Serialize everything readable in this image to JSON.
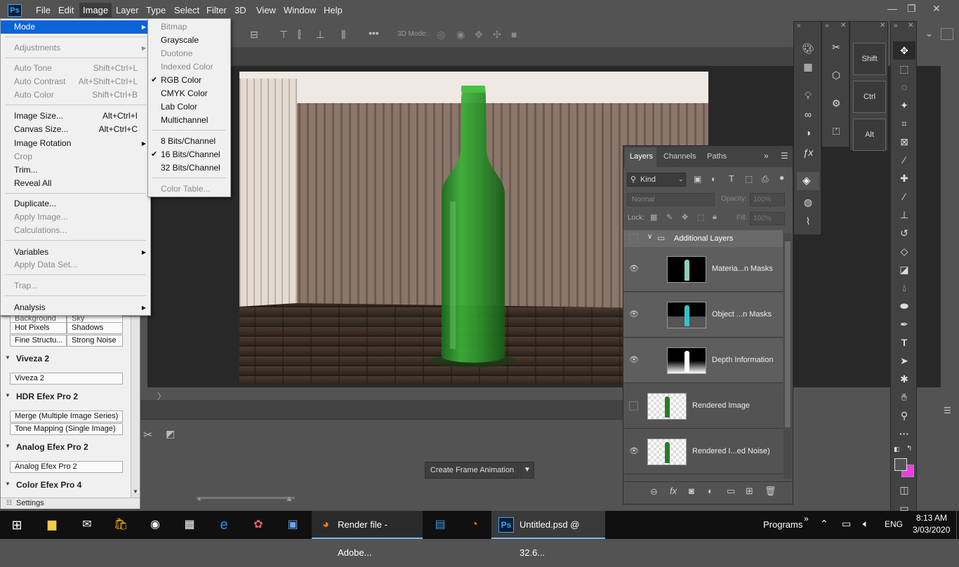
{
  "app": {
    "logo": "Ps"
  },
  "menubar": {
    "items": [
      "File",
      "Edit",
      "Image",
      "Layer",
      "Type",
      "Select",
      "Filter",
      "3D",
      "View",
      "Window",
      "Help"
    ],
    "active": "Image"
  },
  "window_controls": {
    "minimize": "—",
    "restore": "❐",
    "close": "✕"
  },
  "options_bar": {
    "mode_label": "3D Mode:",
    "more": "•••"
  },
  "image_menu": {
    "mode": "Mode",
    "adjustments": "Adjustments",
    "auto_tone": "Auto Tone",
    "auto_tone_sc": "Shift+Ctrl+L",
    "auto_contrast": "Auto Contrast",
    "auto_contrast_sc": "Alt+Shift+Ctrl+L",
    "auto_color": "Auto Color",
    "auto_color_sc": "Shift+Ctrl+B",
    "image_size": "Image Size...",
    "image_size_sc": "Alt+Ctrl+I",
    "canvas_size": "Canvas Size...",
    "canvas_size_sc": "Alt+Ctrl+C",
    "image_rotation": "Image Rotation",
    "crop": "Crop",
    "trim": "Trim...",
    "reveal_all": "Reveal All",
    "duplicate": "Duplicate...",
    "apply_image": "Apply Image...",
    "calculations": "Calculations...",
    "variables": "Variables",
    "apply_data_set": "Apply Data Set...",
    "trap": "Trap...",
    "analysis": "Analysis"
  },
  "mode_submenu": {
    "bitmap": "Bitmap",
    "grayscale": "Grayscale",
    "duotone": "Duotone",
    "indexed_color": "Indexed Color",
    "rgb_color": "RGB Color",
    "cmyk_color": "CMYK Color",
    "lab_color": "Lab Color",
    "multichannel": "Multichannel",
    "bits8": "8 Bits/Channel",
    "bits16": "16 Bits/Channel",
    "bits32": "32 Bits/Channel",
    "color_table": "Color Table...",
    "check": "✔"
  },
  "nik_panel": {
    "row1a": "Background",
    "row1b": "Sky",
    "row2a": "Hot Pixels",
    "row2b": "Shadows",
    "row3a": "Fine Structu...",
    "row3b": "Strong Noise",
    "viveza_head": "Viveza 2",
    "viveza_btn": "Viveza 2",
    "hdr_head": "HDR Efex Pro 2",
    "hdr_btn1": "Merge (Multiple Image Series)",
    "hdr_btn2": "Tone Mapping (Single Image)",
    "analog_head": "Analog Efex Pro 2",
    "analog_btn": "Analog Efex Pro 2",
    "color_head": "Color Efex Pro 4",
    "settings": "Settings"
  },
  "timeline": {
    "create_frame_animation": "Create Frame Animation"
  },
  "layers_panel": {
    "tabs": {
      "layers": "Layers",
      "channels": "Channels",
      "paths": "Paths"
    },
    "filter_kind": "Kind",
    "blend_mode": "Normal",
    "opacity_label": "Opacity:",
    "opacity_value": "100%",
    "lock_label": "Lock:",
    "fill_label": "Fill:",
    "fill_value": "100%",
    "group_name": "Additional Layers",
    "layers": [
      {
        "name": "Materia...n Masks"
      },
      {
        "name": "Object ...n Masks"
      },
      {
        "name": "Depth Information"
      },
      {
        "name": "Rendered Image"
      },
      {
        "name": "Rendered I...ed Noise)"
      }
    ]
  },
  "keys_panel": {
    "shift": "Shift",
    "ctrl": "Ctrl",
    "alt": "Alt"
  },
  "taskbar": {
    "render_file": "Render file - Adobe...",
    "untitled": "Untitled.psd @ 32.6...",
    "programs": "Programs",
    "language": "ENG",
    "time": "8:13 AM",
    "date": "3/03/2020"
  },
  "colors": {
    "accent": "#0a64d8",
    "bottle": "#2f9a2e",
    "bg_swatch": "#e83fe0"
  }
}
